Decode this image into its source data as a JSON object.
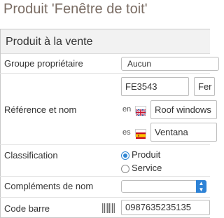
{
  "page": {
    "title": "Produit 'Fenêtre de toit'"
  },
  "section": {
    "header": "Produit à la vente"
  },
  "fields": {
    "owner_group": {
      "label": "Groupe propriétaire",
      "value": "Aucun"
    },
    "reference_name": {
      "label": "Référence et nom",
      "reference": "FE3543",
      "reference_suffix": "Fer",
      "names": [
        {
          "lang": "en",
          "value": "Roof windows",
          "flag": "uk-flag-icon"
        },
        {
          "lang": "es",
          "value": "Ventana",
          "flag": "spain-flag-icon"
        }
      ]
    },
    "classification": {
      "label": "Classification",
      "options": [
        {
          "label": "Produit",
          "checked": true
        },
        {
          "label": "Service",
          "checked": false
        }
      ]
    },
    "name_complements": {
      "label": "Compléments de nom",
      "value": ""
    },
    "barcode": {
      "label": "Code barre",
      "value": "0987635235135"
    }
  },
  "colors": {
    "accent": "#2d82d6",
    "title": "#7a6c63"
  }
}
